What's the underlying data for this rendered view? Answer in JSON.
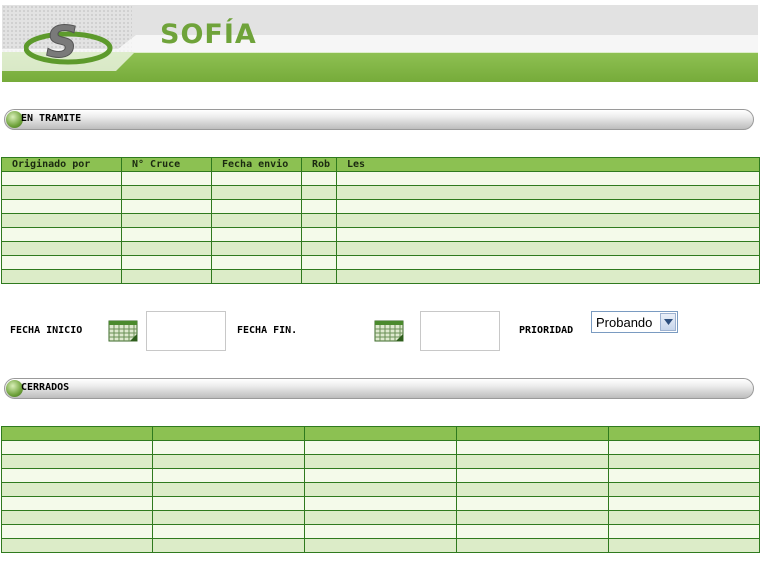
{
  "header": {
    "title": "SOFÍA"
  },
  "sections": {
    "en_tramite": "EN TRAMITE",
    "cerrados": "CERRADOS"
  },
  "tramite_table": {
    "columns": [
      "Originado por",
      "N° Cruce",
      "Fecha envio",
      "Rob",
      "Les"
    ]
  },
  "filters": {
    "fecha_inicio_label": "FECHA INICIO",
    "fecha_fin_label": "FECHA FIN.",
    "prioridad_label": "PRIORIDAD",
    "prioridad_value": "Probando"
  },
  "icons": {
    "calendar": "calendar-icon",
    "dropdown": "chevron-down-icon",
    "section": "bullet-icon",
    "logo": "s-logo-icon"
  },
  "colors": {
    "accent": "#8cc152",
    "row_light": "#f4faea",
    "row_dark": "#dcecc8",
    "border": "#2f7a1e"
  }
}
